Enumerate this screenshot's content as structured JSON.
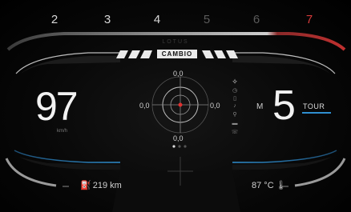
{
  "gear_scale": [
    "2",
    "3",
    "4",
    "5",
    "6",
    "7"
  ],
  "header": {
    "brand": "LOTUS",
    "mode_label": "CAMBIO"
  },
  "speed": {
    "value": "97",
    "unit": "km/h"
  },
  "gear": {
    "mode": "M",
    "current": "5",
    "drive_mode": "TOUR"
  },
  "gforce": {
    "top": "0,0",
    "left": "0,0",
    "right": "0,0",
    "bottom": "0,0"
  },
  "fuel": {
    "range": "219 km"
  },
  "temperature": {
    "value": "87 °C"
  },
  "colors": {
    "accent": "#2f8fd0",
    "redline": "#d43a3a"
  }
}
